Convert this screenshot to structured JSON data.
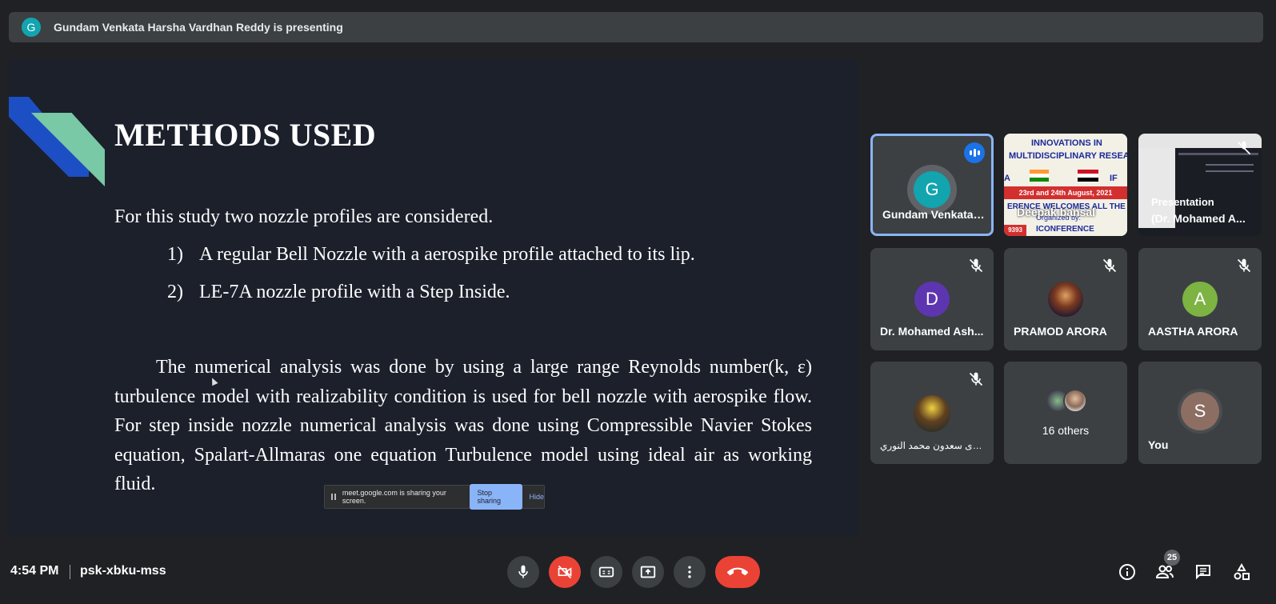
{
  "presenting": {
    "avatar_letter": "G",
    "text": "Gundam Venkata Harsha Vardhan Reddy is presenting"
  },
  "slide": {
    "title": "METHODS USED",
    "intro": "For this study two nozzle profiles are considered.",
    "items": [
      {
        "num": "1)",
        "text": "A regular Bell Nozzle with a aerospike profile attached to its lip."
      },
      {
        "num": "2)",
        "text": "LE-7A nozzle profile with a Step Inside."
      }
    ],
    "paragraph": "The numerical analysis was done by using a large range Reynolds number(k, ε) turbulence model with realizability condition is used for bell nozzle with aerospike flow. For step inside nozzle numerical analysis was done using Compressible Navier Stokes equation, Spalart-Allmaras one equation Turbulence model using ideal air as working fluid."
  },
  "share_notice": {
    "text": "meet.google.com is sharing your screen.",
    "stop": "Stop sharing",
    "hide": "Hide"
  },
  "tiles": [
    {
      "name": "Gundam Venkata ...",
      "letter": "G",
      "color": "#12a4af"
    },
    {
      "name": "Deepak bansal",
      "banner": {
        "l1": "INNOVATIONS IN",
        "l2": "MULTIDISCIPLINARY RESEA",
        "date": "23rd and 24th August, 2021",
        "l4": "ERENCE WELCOMES ALL THE DEL",
        "org": "Organized by:",
        "l6": "ICONFERENCE",
        "code": "9393",
        "ta": "A",
        "tr": "IF"
      }
    },
    {
      "name": "Presentation",
      "name2": "(Dr. Mohamed A..."
    },
    {
      "name": "Dr. Mohamed Ash...",
      "letter": "D",
      "color": "#5e35b1"
    },
    {
      "name": "PRAMOD ARORA"
    },
    {
      "name": "AASTHA ARORA",
      "letter": "A",
      "color": "#7cb342"
    },
    {
      "name": "بشرى سعدون محمد النوري"
    },
    {
      "name": "16 others"
    },
    {
      "name": "You",
      "letter": "S",
      "color": "#8d6e63"
    }
  ],
  "bottom": {
    "time": "4:54 PM",
    "meeting_code": "psk-xbku-mss",
    "participants_count": "25"
  },
  "colors": {
    "background": "#202124",
    "end_call": "#ea4335",
    "accent": "#8ab4f8"
  }
}
